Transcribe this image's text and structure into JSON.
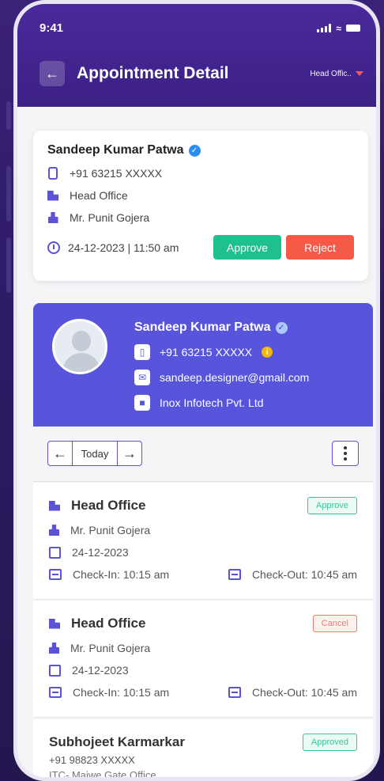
{
  "status_bar": {
    "time": "9:41"
  },
  "header": {
    "title": "Appointment Detail",
    "office_selector": "Head Offic.."
  },
  "card": {
    "name": "Sandeep Kumar Patwa",
    "phone": "+91 63215 XXXXX",
    "office": "Head Office",
    "contact_person": "Mr. Punit Gojera",
    "datetime": "24-12-2023 | 11:50 am",
    "approve_label": "Approve",
    "reject_label": "Reject"
  },
  "profile": {
    "name": "Sandeep Kumar Patwa",
    "phone": "+91 63215 XXXXX",
    "email": "sandeep.designer@gmail.com",
    "company": "Inox Infotech Pvt. Ltd"
  },
  "pager": {
    "today_label": "Today"
  },
  "appointments": [
    {
      "office": "Head Office",
      "status": "Approve",
      "person": "Mr. Punit Gojera",
      "date": "24-12-2023",
      "check_in": "Check-In: 10:15 am",
      "check_out": "Check-Out: 10:45 am"
    },
    {
      "office": "Head Office",
      "status": "Cancel",
      "person": "Mr. Punit Gojera",
      "date": "24-12-2023",
      "check_in": "Check-In: 10:15 am",
      "check_out": "Check-Out: 10:45 am"
    },
    {
      "name": "Subhojeet Karmarkar",
      "status": "Approved",
      "phone": "+91 98823 XXXXX",
      "office": "ITC- Maiwe Gate Office"
    }
  ],
  "colors": {
    "header": "#4a2a9b",
    "accent": "#5854dc",
    "approve": "#1fbf8f",
    "reject": "#f45a47"
  }
}
